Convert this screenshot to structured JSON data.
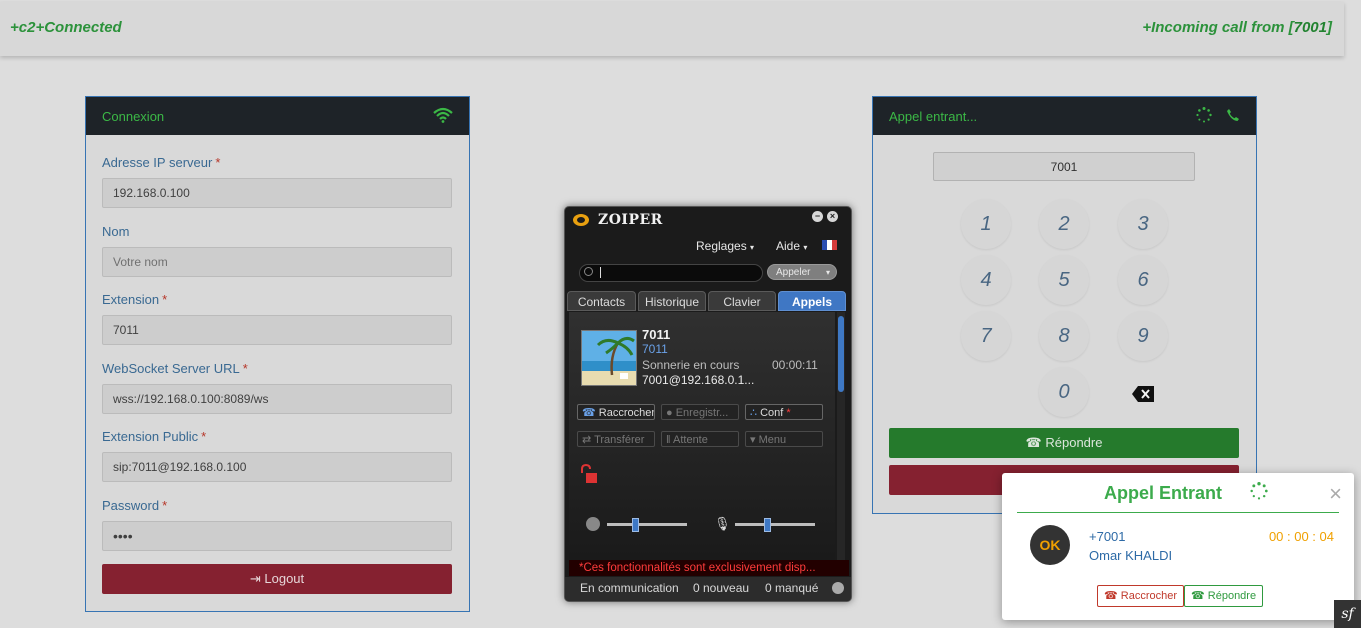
{
  "topbar": {
    "status_left": "+c2+Connected",
    "incoming_prefix": "+Incoming call from [",
    "incoming_number": "7001",
    "incoming_suffix": "]"
  },
  "connexion": {
    "title": "Connexion",
    "fields": [
      {
        "label": "Adresse IP serveur",
        "required": "*",
        "value": "192.168.0.100"
      },
      {
        "label": "Nom",
        "required": "",
        "placeholder": "Votre nom"
      },
      {
        "label": "Extension",
        "required": "*",
        "value": "7011"
      },
      {
        "label": "WebSocket Server URL",
        "required": "*",
        "value": "wss://192.168.0.100:8089/ws"
      },
      {
        "label": "Extension Public",
        "required": "*",
        "value": "sip:7011@192.168.0.100"
      },
      {
        "label": "Password",
        "required": "*",
        "value": "••••"
      }
    ],
    "logout_label": "Logout"
  },
  "incoming": {
    "title": "Appel entrant...",
    "number": "7001",
    "keys": [
      "1",
      "2",
      "3",
      "4",
      "5",
      "6",
      "7",
      "8",
      "9",
      "0"
    ],
    "answer_label": "Répondre"
  },
  "zoiper": {
    "title": "ZOIPER",
    "menu": {
      "settings": "Reglages",
      "help": "Aide"
    },
    "call_button": "Appeler",
    "tabs": [
      "Contacts",
      "Historique",
      "Clavier",
      "Appels"
    ],
    "call": {
      "name": "7011",
      "number": "7011",
      "status": "Sonnerie en cours",
      "duration": "00:00:11",
      "uri": "7001@192.168.0.1..."
    },
    "buttons": {
      "hangup": "Raccrocher",
      "record": "Enregistr...",
      "conf": "Conf",
      "transfer": "Transférer",
      "hold": "Attente",
      "menu": "Menu"
    },
    "volume": {
      "speaker": 0.35,
      "mic": 0.4
    },
    "warning": "*Ces fonctionnalités sont exclusivement disp...",
    "statusbar": {
      "state": "En communication",
      "new": "0 nouveau",
      "missed": "0 manqué"
    }
  },
  "popup": {
    "title": "Appel Entrant",
    "badge": "OK",
    "number": "+7001",
    "name": "Omar KHALDI",
    "timer": "00 : 00 : 04",
    "hangup_label": "Raccrocher",
    "answer_label": "Répondre"
  },
  "colors": {
    "green": "#2f9a3f",
    "danger": "#8d2333",
    "zoiper_accent": "#3f77c4"
  }
}
